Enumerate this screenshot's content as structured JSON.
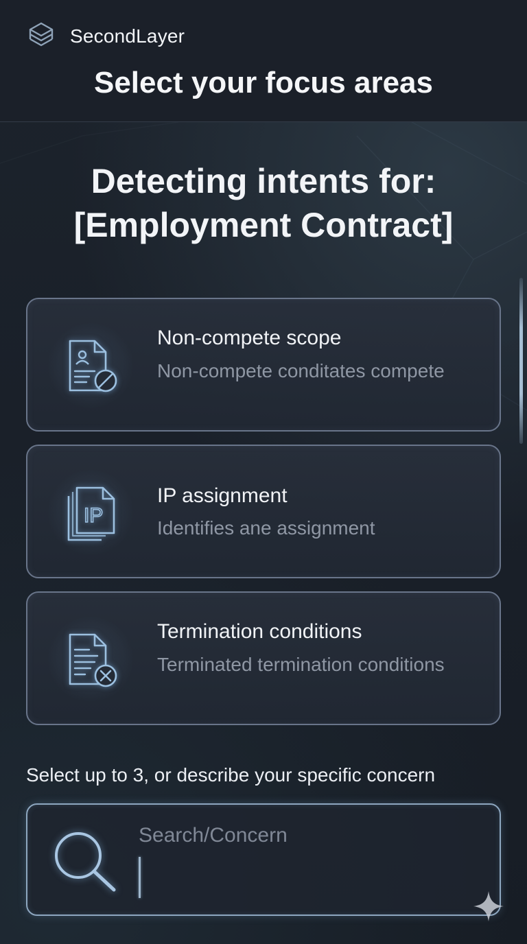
{
  "app": {
    "name": "SecondLayer",
    "logo_icon": "layers-icon"
  },
  "header": {
    "title": "Select your focus areas"
  },
  "intent": {
    "heading_line1": "Detecting intents for:",
    "heading_line2": "[Employment Contract]"
  },
  "focus_areas": [
    {
      "title": "Non-compete scope",
      "description": "Non-compete conditates compete",
      "icon": "document-person-ban-icon"
    },
    {
      "title": "IP assignment",
      "description": "Identifies ane assignment",
      "icon": "document-ip-icon"
    },
    {
      "title": "Termination conditions",
      "description": "Terminated termination conditions",
      "icon": "document-cancel-icon"
    }
  ],
  "selection": {
    "hint": "Select up to 3, or describe your specific concern"
  },
  "search": {
    "placeholder": "Search/Concern",
    "value": "",
    "icon": "search-icon"
  },
  "colors": {
    "background": "#1a2029",
    "card_border": "#69758a",
    "accent_glow": "#8ea7c0",
    "muted_text": "#8f97a4"
  }
}
